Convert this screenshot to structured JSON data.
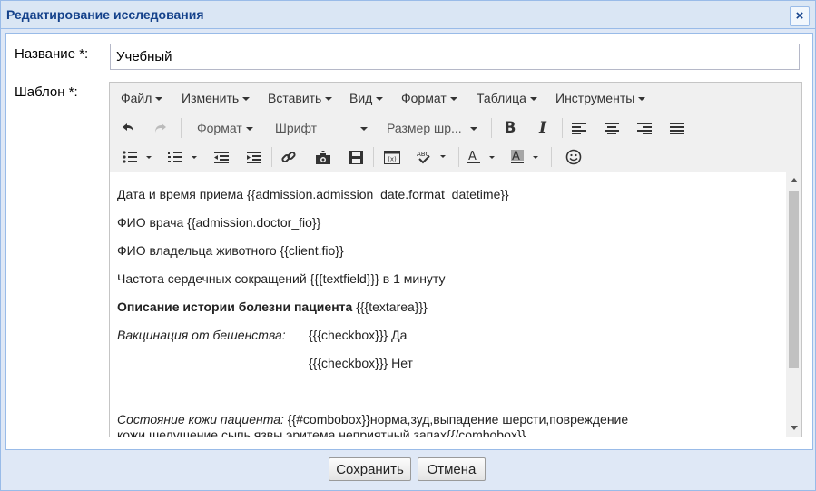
{
  "window": {
    "title": "Редактирование исследования",
    "close_glyph": "×"
  },
  "form": {
    "name_label": "Название *:",
    "name_value": "Учебный",
    "template_label": "Шаблон *:"
  },
  "editor": {
    "menu": [
      "Файл",
      "Изменить",
      "Вставить",
      "Вид",
      "Формат",
      "Таблица",
      "Инструменты"
    ],
    "toolbar": {
      "format_label": "Формат",
      "font_label": "Шрифт",
      "size_label": "Размер шр..."
    },
    "icons": [
      "undo-icon",
      "redo-icon",
      "bold-icon",
      "italic-icon",
      "align-left-icon",
      "align-center-icon",
      "align-right-icon",
      "align-justify-icon",
      "bullet-list-icon",
      "numbered-list-icon",
      "outdent-icon",
      "indent-icon",
      "link-icon",
      "image-icon",
      "save-icon",
      "template-variable-icon",
      "spellcheck-icon",
      "text-color-icon",
      "background-color-icon",
      "emoticon-icon"
    ],
    "content": {
      "line1": "Дата и время приема {{admission.admission_date.format_datetime}}",
      "line2": "ФИО врача {{admission.doctor_fio}}",
      "line3": "ФИО владельца животного {{client.fio}}",
      "line4": "Частота сердечных сокращений {{{textfield}}} в 1 минуту",
      "line5_bold": "Описание истории болезни пациента",
      "line5_rest": " {{{textarea}}}",
      "line6_italic": "Вакцинация от бешенства:",
      "line6_rest": "{{{checkbox}}} Да",
      "line7": "{{{checkbox}}} Нет",
      "line8_italic": "Состояние кожи пациента:",
      "line8_rest": " {{#combobox}}норма,зуд,выпадение шерсти,повреждение",
      "line9": "кожи,шелушение,сыпь,язвы,эритема,неприятный запах{{/combobox}}"
    }
  },
  "buttons": {
    "save": "Сохранить",
    "cancel": "Отмена"
  }
}
